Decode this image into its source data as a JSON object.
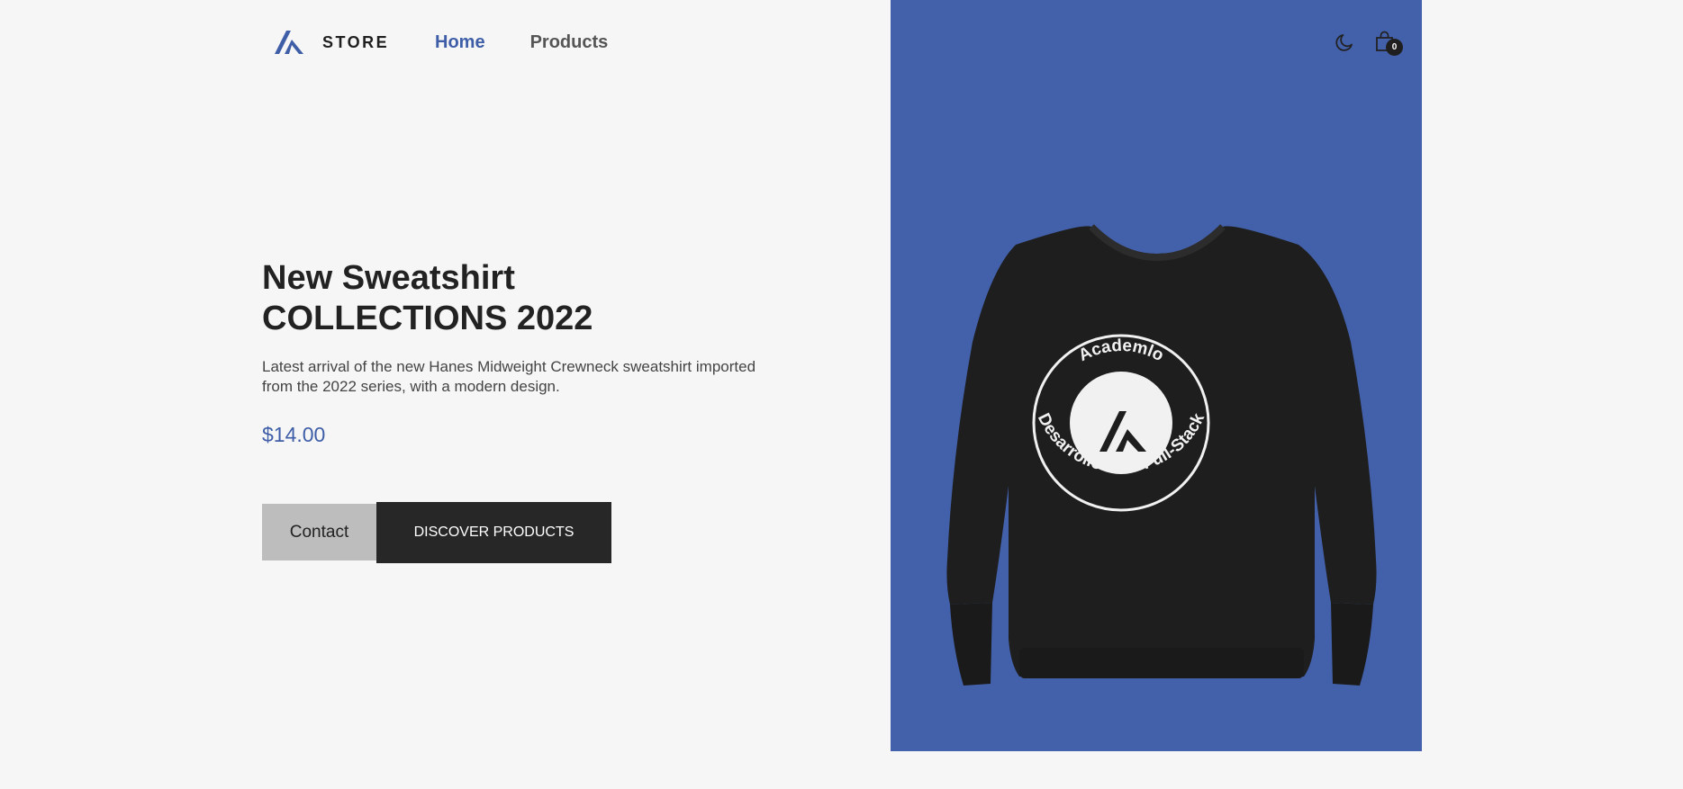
{
  "brand": {
    "name": "STORE"
  },
  "nav": {
    "home": "Home",
    "products": "Products"
  },
  "header_icons": {
    "theme_icon": "moon-icon",
    "cart_icon": "shopping-bag-icon",
    "cart_count": "0"
  },
  "hero": {
    "title_line1": "New Sweatshirt",
    "title_line2": "COLLECTIONS 2022",
    "description_line1": "Latest arrival of the new Hanes Midweight Crewneck sweatshirt imported",
    "description_line2": "from the 2022 series, with a modern design.",
    "price": "$14.00",
    "contact_label": "Contact",
    "discover_label": "DISCOVER PRODUCTS"
  },
  "product_print": {
    "top_text": "Academlo",
    "bottom_text": "Desarrollo Web Full-Stack"
  },
  "colors": {
    "accent": "#3f5ea8",
    "panel": "#4361ab",
    "background": "#f6f6f6",
    "dark": "#272727"
  }
}
